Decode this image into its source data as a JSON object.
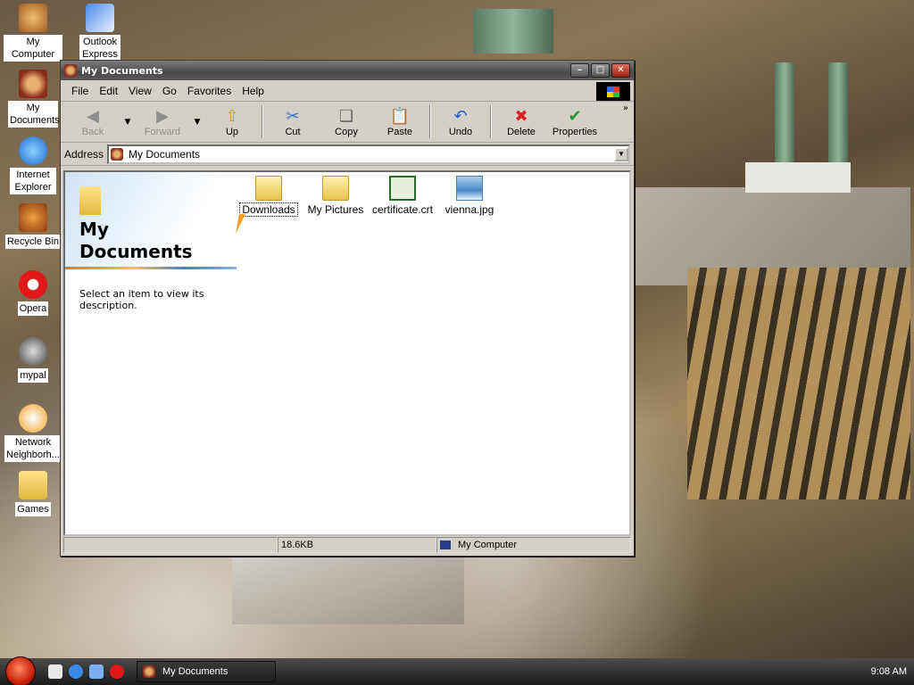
{
  "desktop": {
    "icons": [
      {
        "label": "My Computer"
      },
      {
        "label": "Outlook Express"
      },
      {
        "label": "My Documents"
      },
      {
        "label": "Internet Explorer"
      },
      {
        "label": "Recycle Bin"
      },
      {
        "label": "Opera"
      },
      {
        "label": "mypal"
      },
      {
        "label": "Network Neighborh..."
      },
      {
        "label": "Games"
      }
    ]
  },
  "window": {
    "title": "My Documents",
    "menu": [
      "File",
      "Edit",
      "View",
      "Go",
      "Favorites",
      "Help"
    ],
    "toolbar": {
      "back": "Back",
      "forward": "Forward",
      "up": "Up",
      "cut": "Cut",
      "copy": "Copy",
      "paste": "Paste",
      "undo": "Undo",
      "delete": "Delete",
      "properties": "Properties"
    },
    "address": {
      "label": "Address",
      "value": "My Documents"
    },
    "webview": {
      "title_line1": "My",
      "title_line2": "Documents",
      "description": "Select an item to view its description."
    },
    "files": [
      {
        "name": "Downloads",
        "type": "folder"
      },
      {
        "name": "My Pictures",
        "type": "folder"
      },
      {
        "name": "certificate.crt",
        "type": "certificate"
      },
      {
        "name": "vienna.jpg",
        "type": "image"
      }
    ],
    "status": {
      "size": "18.6KB",
      "zone": "My Computer"
    }
  },
  "taskbar": {
    "task": "My Documents",
    "clock": "9:08 AM"
  }
}
